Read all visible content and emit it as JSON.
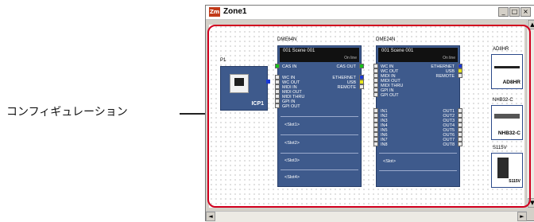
{
  "callout_label": "コンフィギュレーション",
  "window": {
    "title": "Zone1",
    "app_icon_text": "Zm",
    "minimize_symbol": "_",
    "maximize_symbol": "□",
    "close_symbol": "×"
  },
  "scroll": {
    "up": "▲",
    "down": "▼",
    "left": "◄",
    "right": "►"
  },
  "icp": {
    "label": "P1",
    "name": "ICP1"
  },
  "dme64": {
    "label": "DME64N",
    "scene": "001 Scene 001",
    "online": "On line",
    "left_ports": [
      "CAS IN",
      "WC IN",
      "WC OUT",
      "MIDI IN",
      "MIDI OUT",
      "MIDI THRU",
      "GPI IN",
      "GPI OUT"
    ],
    "right_ports": [
      "CAS OUT",
      "ETHERNET",
      "USB",
      "REMOTE"
    ],
    "slots": [
      "<Slot1>",
      "<Slot2>",
      "<Slot3>",
      "<Slot4>"
    ]
  },
  "dme24": {
    "label": "DME24N",
    "scene": "001 Scene 001",
    "online": "On line",
    "left_ports": [
      "WC IN",
      "WC OUT",
      "MIDI IN",
      "MIDI OUT",
      "MIDI THRU",
      "GPI IN",
      "GPI OUT"
    ],
    "right_ports": [
      "ETHERNET",
      "USB",
      "REMOTE"
    ],
    "inputs": [
      "IN1",
      "IN2",
      "IN3",
      "IN4",
      "IN5",
      "IN6",
      "IN7",
      "IN8"
    ],
    "outputs": [
      "OUT1",
      "OUT2",
      "OUT3",
      "OUT4",
      "OUT5",
      "OUT6",
      "OUT7",
      "OUT8"
    ],
    "slot": "<Slot>"
  },
  "devices": [
    {
      "label": "AD8HR",
      "name": "AD8HR"
    },
    {
      "label": "NHB32-C",
      "name": "NHB32-C"
    },
    {
      "label": "S115V",
      "name": "S115V"
    }
  ],
  "colors": {
    "highlight": "#d0001f",
    "component_bg": "#3e5a8c",
    "port_link": "#1a39d6"
  }
}
